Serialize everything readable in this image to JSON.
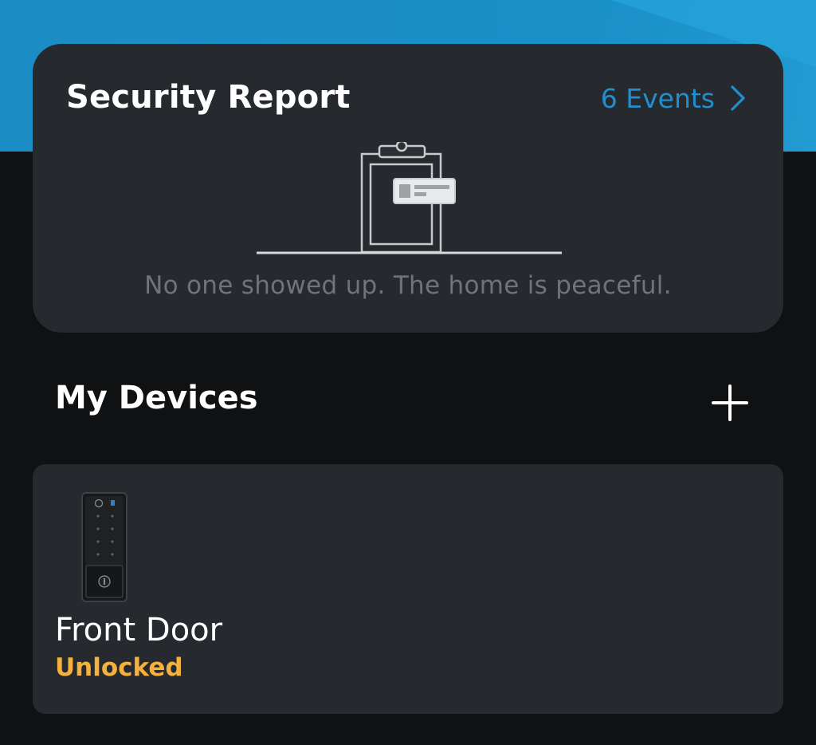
{
  "security_report": {
    "title": "Security Report",
    "events_label": "6 Events",
    "empty_message": "No one showed up. The home is peaceful."
  },
  "devices_section": {
    "title": "My Devices"
  },
  "devices": [
    {
      "name": "Front Door",
      "status": "Unlocked",
      "status_color": "#f5b13b"
    }
  ],
  "colors": {
    "accent": "#1f8fd0",
    "banner": "#1a8fc8",
    "card": "#262a2e",
    "background": "#101112"
  },
  "icons": {
    "events_arrow": "chevron-right-icon",
    "add": "plus-icon",
    "illustration": "clipboard-report-icon"
  }
}
